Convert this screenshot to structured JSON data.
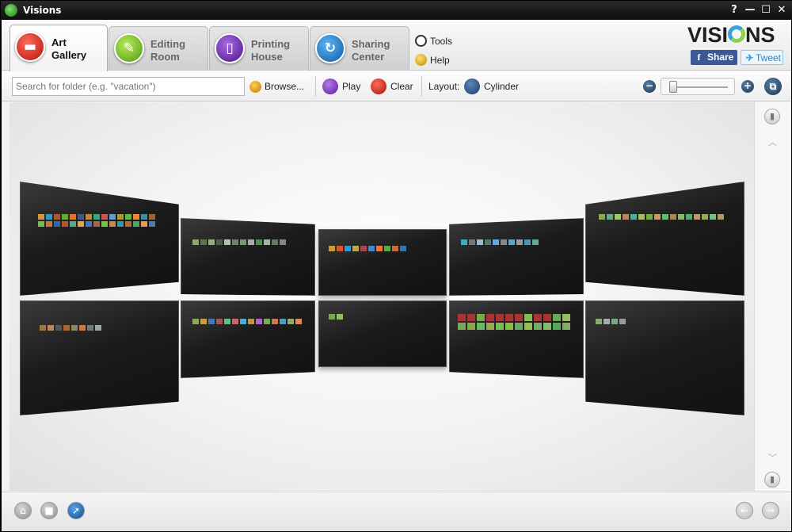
{
  "window": {
    "title": "Visions",
    "controls": [
      "?",
      "—",
      "☐",
      "✕"
    ]
  },
  "tabs": [
    {
      "line1": "Art",
      "line2": "Gallery",
      "icon": "film-strip-icon",
      "active": true
    },
    {
      "line1": "Editing",
      "line2": "Room",
      "icon": "brush-icon",
      "active": false
    },
    {
      "line1": "Printing",
      "line2": "House",
      "icon": "document-icon",
      "active": false
    },
    {
      "line1": "Sharing",
      "line2": "Center",
      "icon": "share-arrows-icon",
      "active": false
    }
  ],
  "menu": {
    "tools": "Tools",
    "help": "Help"
  },
  "brand": {
    "logo": "VISIONS",
    "logo_left": "VISI",
    "logo_right": "NS"
  },
  "social": {
    "facebook": "Share",
    "twitter": "Tweet"
  },
  "toolbar": {
    "search_placeholder": "Search for folder (e.g. \"vacation\")",
    "browse": "Browse...",
    "play": "Play",
    "clear": "Clear",
    "layout_label": "Layout:",
    "layout_value": "Cylinder"
  },
  "zoom": {
    "level": 0.05
  },
  "colors": {
    "accent_red": "#d0241a",
    "accent_green": "#6cbf2a",
    "accent_purple": "#6a2aa8",
    "accent_blue": "#1b78c8",
    "facebook": "#3b5998",
    "twitter": "#3aa3e3"
  }
}
